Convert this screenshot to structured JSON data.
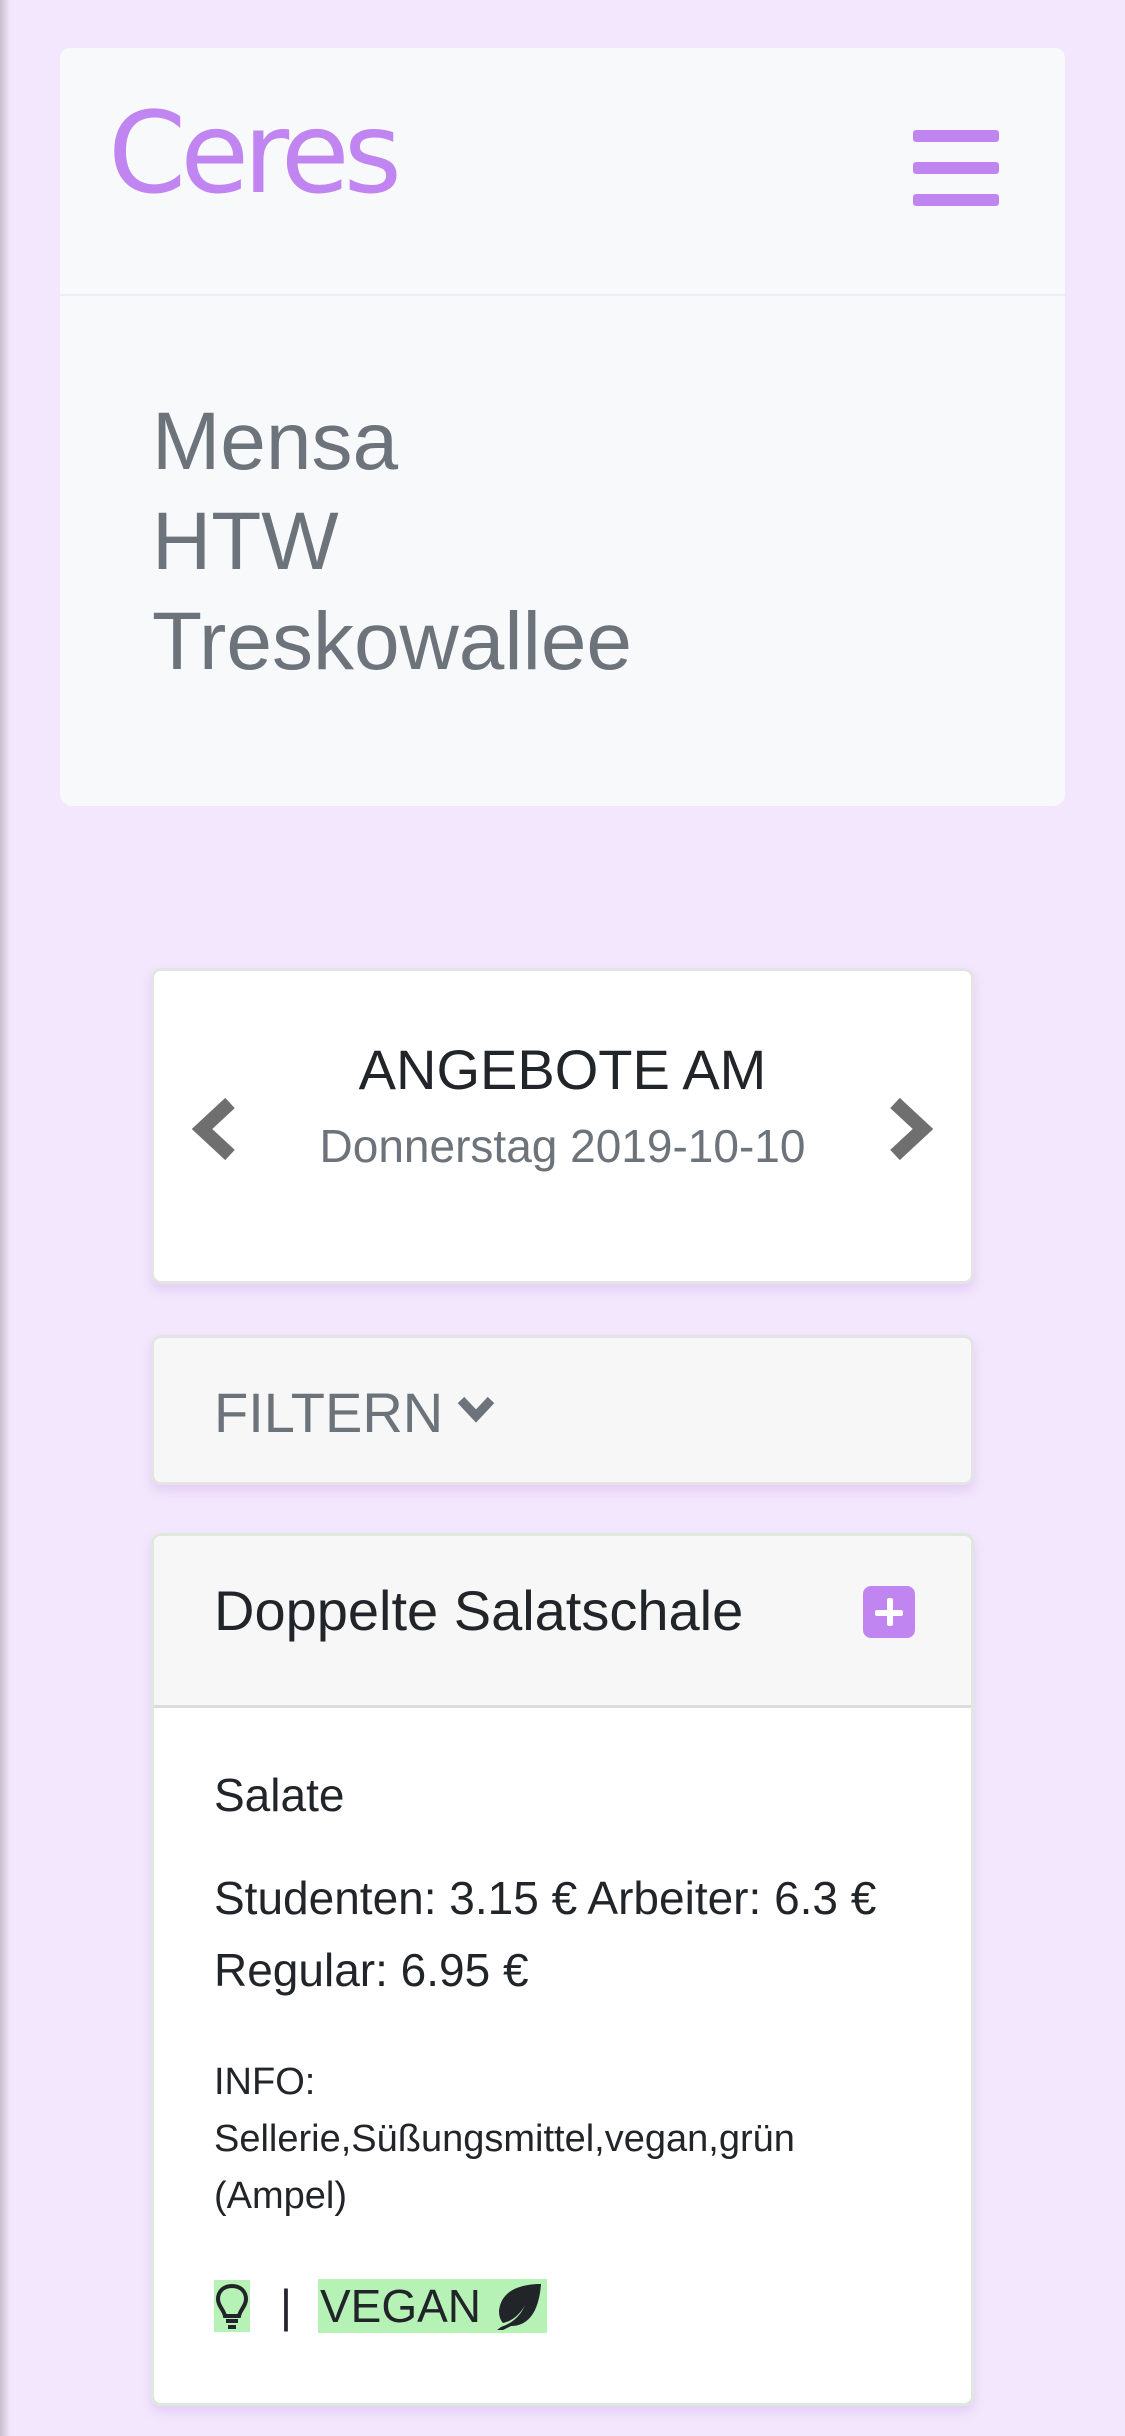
{
  "navbar": {
    "brand": "Ceres",
    "menu_icon": "hamburger-menu-icon"
  },
  "mensa": {
    "name_lines": [
      "Mensa",
      "HTW",
      "Treskowallee"
    ]
  },
  "date_selector": {
    "heading": "ANGEBOTE AM",
    "date": "Donnerstag 2019-10-10",
    "prev_icon": "chevron-left-icon",
    "next_icon": "chevron-right-icon"
  },
  "filter": {
    "label": "FILTERN",
    "icon": "chevron-down-icon"
  },
  "meal": {
    "title": "Doppelte Salatschale",
    "add_icon": "plus-square-icon",
    "category": "Salate",
    "prices": "Studenten: 3.15 € Arbeiter: 6.3 € Regular: 6.95 €",
    "info_label": "INFO:",
    "info": "Sellerie,Süßungsmittel,vegan,grün (Ampel)",
    "separator": "|",
    "vegan_label": "VEGAN",
    "bulb_icon": "lightbulb-icon",
    "leaf_icon": "leaf-icon"
  },
  "colors": {
    "accent": "#c185f2",
    "page_background": "#f2e7fc",
    "vegan_highlight": "#b6f2b6",
    "muted_text": "#6c737a"
  }
}
